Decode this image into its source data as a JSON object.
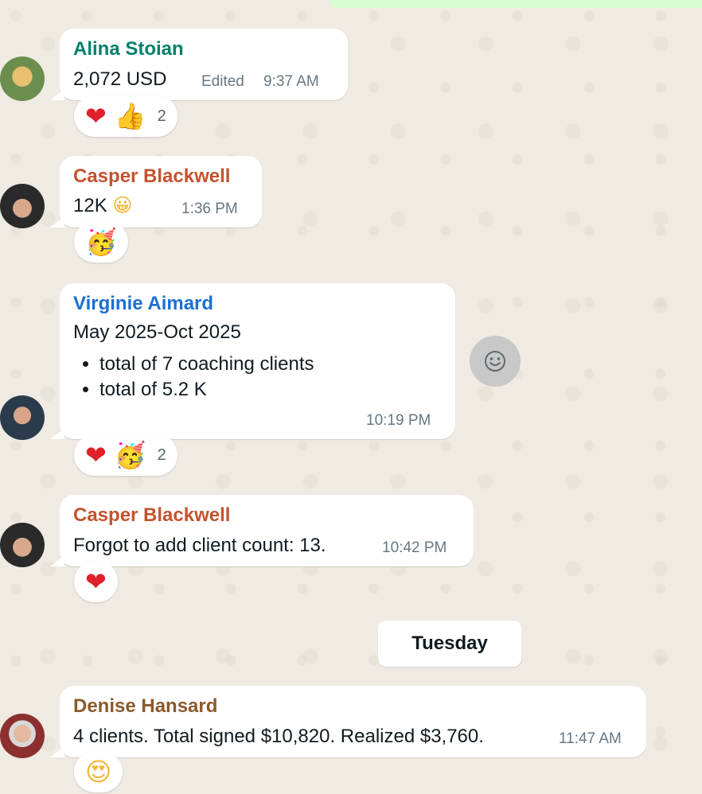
{
  "colors": {
    "alina": "#00806a",
    "casper": "#c4522e",
    "virginie": "#1a6fd1",
    "denise": "#8a5a2b"
  },
  "messages": [
    {
      "sender": "Alina Stoian",
      "text": "2,072 USD",
      "edited": "Edited",
      "time": "9:37 AM",
      "reactions": [
        "heart",
        "thumbs-up"
      ],
      "reaction_count": "2"
    },
    {
      "sender": "Casper Blackwell",
      "text": "12K",
      "time": "1:36 PM",
      "reactions": [
        "party-face"
      ]
    },
    {
      "sender": "Virginie Aimard",
      "text": "May 2025-Oct 2025",
      "bullets": [
        "total of 7 coaching clients",
        "total of 5.2 K"
      ],
      "time": "10:19 PM",
      "reactions": [
        "heart",
        "party-face"
      ],
      "reaction_count": "2"
    },
    {
      "sender": "Casper Blackwell",
      "text": "Forgot to add client count: 13.",
      "time": "10:42 PM",
      "reactions": [
        "heart"
      ]
    },
    {
      "sender": "Denise Hansard",
      "text": "4 clients. Total signed $10,820. Realized $3,760.",
      "time": "11:47 AM",
      "reactions": [
        "heart-eyes"
      ]
    }
  ],
  "date_separator": "Tuesday",
  "icons": {
    "react": "smiley-icon"
  }
}
